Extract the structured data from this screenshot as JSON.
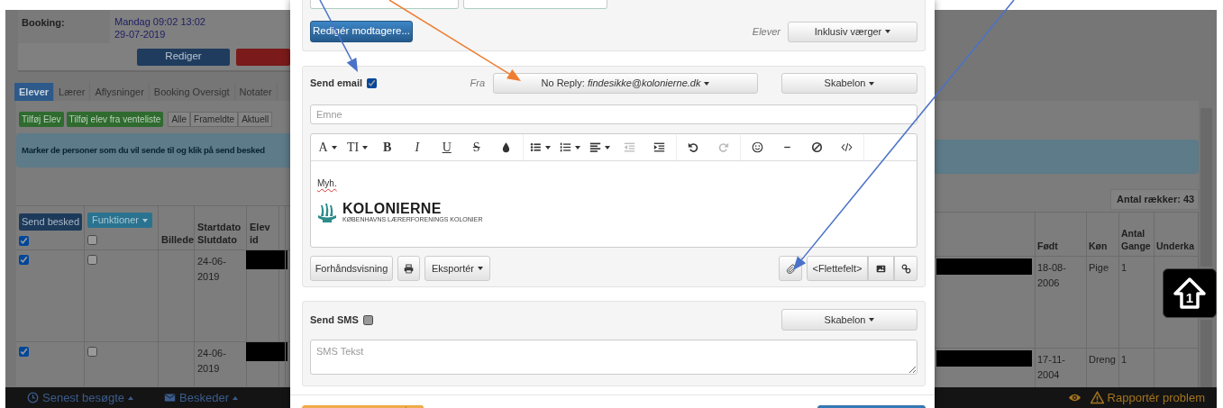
{
  "background_page": {
    "booking": {
      "label": "Booking:",
      "value": "Mandag  09:02 13:02\n29-07-2019",
      "edit_button": "Rediger"
    },
    "tabs": [
      {
        "label": "Elever",
        "selected": true
      },
      {
        "label": "Lærer",
        "selected": false
      },
      {
        "label": "Aflysninger",
        "selected": false
      },
      {
        "label": "Booking Oversigt",
        "selected": false
      },
      {
        "label": "Notater",
        "selected": false
      }
    ],
    "action_buttons": [
      "Tilføj Elev",
      "Tilføj elev fra venteliste"
    ],
    "filters": [
      "Alle",
      "Frameldte",
      "Aktuell"
    ],
    "info": "Marker de personer som du vil sende til og klik på send besked",
    "row_count": "Antal rækker: 43",
    "table": {
      "send_button": "Send besked",
      "functions_button": "Funktioner",
      "header_send_checked": true,
      "header_checked": false,
      "columns_left": [
        "Billede",
        "Startdato\nSlutdato",
        "Elev\nid"
      ],
      "columns_right": [
        "Født",
        "Køn",
        "Antal\nGange",
        "Underka"
      ],
      "rows": [
        {
          "send_checked": true,
          "checked": false,
          "date": "24-06-2019",
          "born": "18-08-2006",
          "gender": "Pige",
          "count": "1"
        },
        {
          "send_checked": true,
          "checked": false,
          "date": "24-06-2019",
          "born": "17-11-2004",
          "gender": "Dreng",
          "count": "1"
        }
      ]
    },
    "footer_left": [
      {
        "kind": "clock",
        "label": "Senest besøgte"
      },
      {
        "kind": "envelope",
        "label": "Beskeder"
      }
    ],
    "footer_right": [
      {
        "kind": "eye"
      },
      {
        "kind": "warning",
        "label": "Rapportér problem"
      }
    ]
  },
  "scroll_top_badge": {
    "label": "1"
  },
  "modal": {
    "recipients_button": "Redigér modtagere...",
    "recipient_group": "Elever",
    "guardian_dropdown": "Inklusiv værger",
    "email": {
      "label": "Send email",
      "checked": true,
      "from_label": "Fra",
      "from": "No Reply: *findesikke@kolonierne.dk*",
      "template": "Skabelon",
      "subject_placeholder": "Emne",
      "toolbar": [
        [
          {
            "kind": "letter",
            "label": "A",
            "caret": true,
            "disabled": false
          },
          {
            "kind": "letter",
            "label": "TI",
            "caret": true,
            "disabled": false
          },
          {
            "kind": "bold",
            "label": "B",
            "disabled": false
          },
          {
            "kind": "italic",
            "label": "I",
            "disabled": false
          },
          {
            "kind": "underline",
            "label": "U",
            "disabled": false
          },
          {
            "kind": "strike",
            "label": "S",
            "disabled": false
          },
          {
            "kind": "droplet",
            "disabled": false
          }
        ],
        [
          {
            "kind": "bullets",
            "caret": true,
            "disabled": false
          },
          {
            "kind": "numbers",
            "caret": true,
            "disabled": false
          },
          {
            "kind": "align",
            "caret": true,
            "disabled": false
          },
          {
            "kind": "outdent",
            "disabled": true
          },
          {
            "kind": "indent",
            "disabled": false
          }
        ],
        [
          {
            "kind": "undo",
            "disabled": false
          },
          {
            "kind": "redo",
            "disabled": true
          }
        ],
        [
          {
            "kind": "smiley",
            "disabled": false
          },
          {
            "kind": "rule",
            "disabled": false
          },
          {
            "kind": "clear",
            "disabled": false
          },
          {
            "kind": "code",
            "disabled": false
          }
        ]
      ],
      "body_text": "Myh.",
      "logo": {
        "name": "KOLONIERNE",
        "tagline": "KØBENHAVNS LÆRERFORENINGS KOLONIER"
      },
      "buttons_left": [
        {
          "kind": "text",
          "label": "Forhåndsvisning"
        },
        {
          "kind": "print"
        },
        {
          "kind": "text",
          "label": "Eksportér",
          "caret": true
        }
      ],
      "attach_button": {
        "kind": "paperclip"
      },
      "buttons_right": [
        {
          "kind": "text",
          "label": "<Flettefelt>"
        },
        {
          "kind": "image"
        },
        {
          "kind": "link"
        }
      ]
    },
    "sms": {
      "label": "Send SMS",
      "checked": false,
      "template": "Skabelon",
      "placeholder": "SMS Tekst"
    }
  },
  "annotation_arrows": [
    {
      "color": "#4a72c8"
    },
    {
      "color": "#ee7d31"
    },
    {
      "color": "#4a72c8"
    }
  ]
}
